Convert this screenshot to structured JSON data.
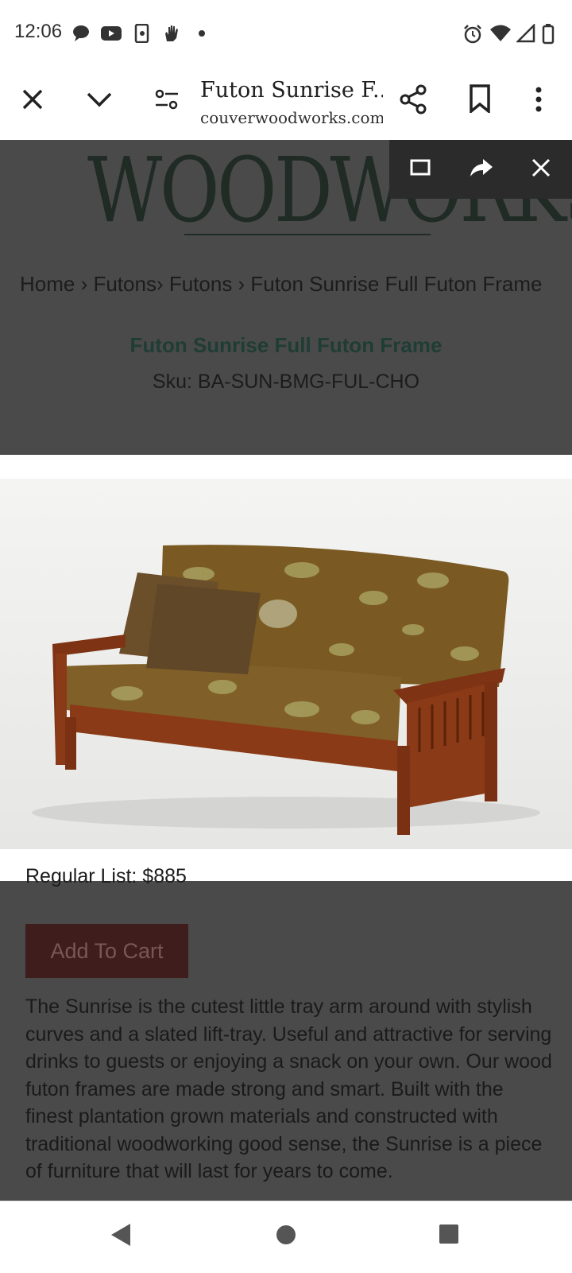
{
  "status_bar": {
    "time": "12:06",
    "left_icons": [
      "chat-bubble-icon",
      "youtube-icon",
      "phone-screen-icon",
      "hand-icon",
      "dot-icon"
    ],
    "right_icons": [
      "alarm-icon",
      "wifi-icon",
      "cell-signal-icon",
      "battery-icon"
    ]
  },
  "toolbar": {
    "page_title": "Futon Sunrise F...",
    "url": "couverwoodworks.com",
    "icons": [
      "close-icon",
      "chevron-down-icon",
      "tune-icon",
      "share-icon",
      "bookmark-icon",
      "more-vert-icon"
    ]
  },
  "overlay": {
    "icons": [
      "fullscreen-icon",
      "forward-share-icon",
      "close-icon"
    ]
  },
  "page": {
    "logo_text": "WOODWORKS",
    "breadcrumb": "Home › Futons› Futons › Futon Sunrise Full Futon Frame",
    "product_title": "Futon Sunrise Full Futon Frame",
    "sku": "Sku: BA-SUN-BMG-FUL-CHO",
    "regular_list": "Regular List: $885",
    "add_to_cart": "Add To Cart",
    "description": "The Sunrise is the cutest little tray arm around with stylish curves and a slated lift-tray. Useful and attractive for serving drinks to guests or enjoying a snack on your own. Our wood futon frames are made strong and smart. Built with the finest plantation grown materials and constructed with traditional woodworking good sense, the Sunrise is a piece of furniture that will last for years to come."
  },
  "colors": {
    "dim_overlay": "#4a4a4a",
    "title_green": "#1f3d34",
    "cart_button": "#3f1d1d",
    "wood": "#8a3a16",
    "fabric": "#7a5a22"
  },
  "nav_bar": {
    "icons": [
      "back-triangle-icon",
      "home-circle-icon",
      "recents-square-icon"
    ]
  }
}
